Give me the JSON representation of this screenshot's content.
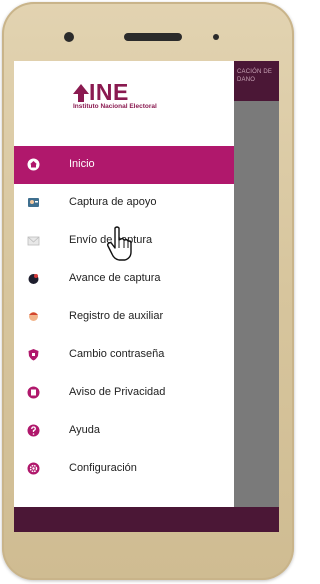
{
  "overlay": {
    "header_text": "CACIÓN DE DANO"
  },
  "logo": {
    "word": "INE",
    "subtitle": "Instituto Nacional Electoral"
  },
  "menu": [
    {
      "label": "Inicio",
      "icon": "home-icon",
      "active": true
    },
    {
      "label": "Captura de apoyo",
      "icon": "id-card-capture-icon",
      "active": false
    },
    {
      "label": "Envío de captura",
      "icon": "envelope-icon",
      "active": false
    },
    {
      "label": "Avance de captura",
      "icon": "progress-blob-icon",
      "active": false
    },
    {
      "label": "Registro de auxiliar",
      "icon": "person-icon",
      "active": false
    },
    {
      "label": "Cambio contraseña",
      "icon": "shield-icon",
      "active": false
    },
    {
      "label": "Aviso de Privacidad",
      "icon": "privacy-book-icon",
      "active": false
    },
    {
      "label": "Ayuda",
      "icon": "help-icon",
      "active": false
    },
    {
      "label": "Configuración",
      "icon": "gear-icon",
      "active": false
    }
  ],
  "colors": {
    "brand": "#8a1a50",
    "active_bg": "#b0186c",
    "footer": "#4b1736",
    "overlay": "#7a7a7a"
  }
}
